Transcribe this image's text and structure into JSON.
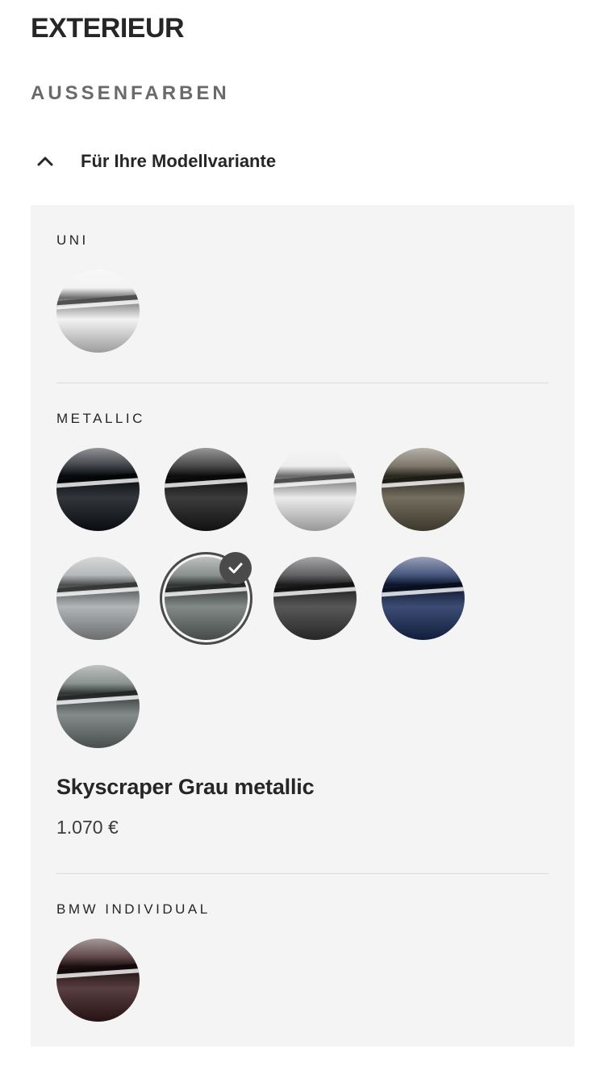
{
  "header": {
    "title": "EXTERIEUR",
    "section": "AUSSENFARBEN"
  },
  "accordion": {
    "label": "Für Ihre Modellvariante",
    "expanded": true
  },
  "groups": {
    "uni": {
      "label": "UNI"
    },
    "metallic": {
      "label": "METALLIC"
    },
    "individual": {
      "label": "BMW INDIVIDUAL"
    }
  },
  "swatch_colors": {
    "uni_white": "#f0f0f0",
    "black_sapphire": "#0e1218",
    "carbon_black": "#1a1a1a",
    "mineral_white": "#e8e8e8",
    "olive_bronze": "#5c5444",
    "brooklyn_grey": "#a4a8aa",
    "skyscraper_grey": "#6c7472",
    "dravit_grey": "#3a3a3c",
    "portimao_blue": "#1a2c5c",
    "sage_grey": "#6e7876",
    "individual_red": "#3a1c1e"
  },
  "selected": {
    "name": "Skyscraper Grau metallic",
    "price": "1.070 €"
  },
  "accent_color": "#4a4a4a"
}
